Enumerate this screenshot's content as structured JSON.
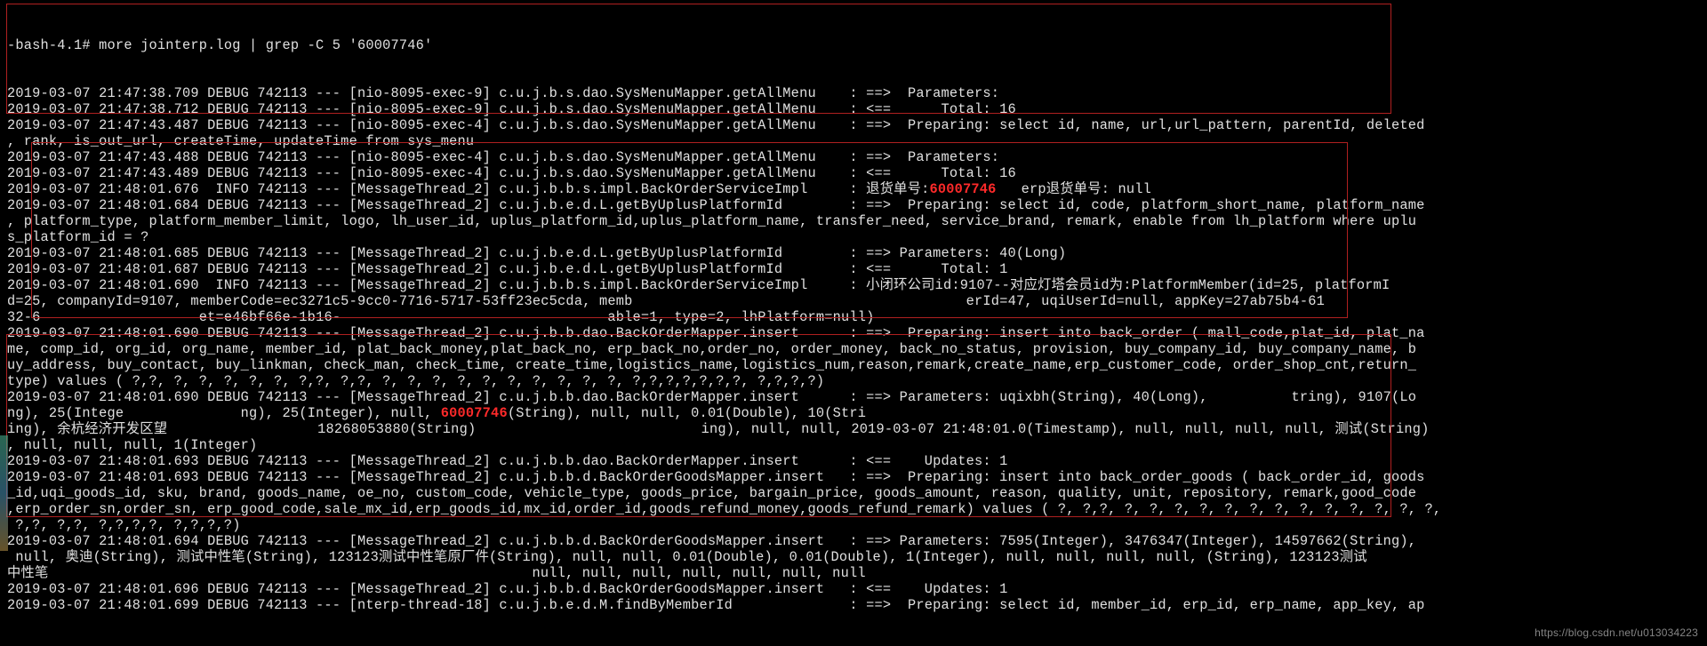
{
  "prompt": "-bash-4.1# more jointerp.log | grep -C 5 '60007746'",
  "highlight": "60007746",
  "watermark": "https://blog.csdn.net/u013034223",
  "lines": [
    "2019-03-07 21:47:38.709 DEBUG 742113 --- [nio-8095-exec-9] c.u.j.b.s.dao.SysMenuMapper.getAllMenu    : ==>  Parameters: ",
    "2019-03-07 21:47:38.712 DEBUG 742113 --- [nio-8095-exec-9] c.u.j.b.s.dao.SysMenuMapper.getAllMenu    : <==      Total: 16",
    "2019-03-07 21:47:43.487 DEBUG 742113 --- [nio-8095-exec-4] c.u.j.b.s.dao.SysMenuMapper.getAllMenu    : ==>  Preparing: select id, name, url,url_pattern, parentId, deleted",
    ", rank, is_out_url, createTime, updateTime from sys_menu ",
    "2019-03-07 21:47:43.488 DEBUG 742113 --- [nio-8095-exec-4] c.u.j.b.s.dao.SysMenuMapper.getAllMenu    : ==>  Parameters: ",
    "2019-03-07 21:47:43.489 DEBUG 742113 --- [nio-8095-exec-4] c.u.j.b.s.dao.SysMenuMapper.getAllMenu    : <==      Total: 16",
    "2019-03-07 21:48:01.676  INFO 742113 --- [MessageThread_2] c.u.j.b.b.s.impl.BackOrderServiceImpl     : 退货单号:{HL}   erp退货单号: null",
    "2019-03-07 21:48:01.684 DEBUG 742113 --- [MessageThread_2] c.u.j.b.e.d.L.getByUplusPlatformId        : ==>  Preparing: select id, code, platform_short_name, platform_name",
    ", platform_type, platform_member_limit, logo, lh_user_id, uplus_platform_id,uplus_platform_name, transfer_need, service_brand, remark, enable from lh_platform where uplu",
    "s_platform_id = ? ",
    "2019-03-07 21:48:01.685 DEBUG 742113 --- [MessageThread_2] c.u.j.b.e.d.L.getByUplusPlatformId        : ==> Parameters: 40(Long)",
    "2019-03-07 21:48:01.687 DEBUG 742113 --- [MessageThread_2] c.u.j.b.e.d.L.getByUplusPlatformId        : <==      Total: 1",
    "2019-03-07 21:48:01.690  INFO 742113 --- [MessageThread_2] c.u.j.b.b.s.impl.BackOrderServiceImpl     : 小闭环公司id:9107--对应灯塔会员id为:PlatformMember(id=25, platformI",
    "d=25, companyId=9107, memberCode=ec3271c5-9cc0-7716-5717-53ff23ec5cda, memb████████████████████████████████████████erId=47, uqiUserId=null, appKey=27ab75b4-61",
    "32-6███████████████████et=e46bf66e-1b16-████████████████████████████████able=1, type=2, lhPlatform=null)",
    "2019-03-07 21:48:01.690 DEBUG 742113 --- [MessageThread_2] c.u.j.b.b.dao.BackOrderMapper.insert      : ==>  Preparing: insert into back_order ( mall_code,plat_id, plat_na",
    "me, comp_id, org_id, org_name, member_id, plat_back_money,plat_back_no, erp_back_no,order_no, order_money, back_no_status, provision, buy_company_id, buy_company_name, b",
    "uy_address, buy_contact, buy_linkman, check_man, check_time, create_time,logistics_name,logistics_num,reason,remark,create_name,erp_customer_code, order_shop_cnt,return_",
    "type) values ( ?,?, ?, ?, ?, ?, ?, ?,?, ?,?, ?, ?, ?, ?, ?, ?, ?, ?, ?, ?, ?,?,?,?,?,?,?, ?,?,?,?) ",
    "2019-03-07 21:48:01.690 DEBUG 742113 --- [MessageThread_2] c.u.j.b.b.dao.BackOrderMapper.insert      : ==> Parameters: uqixbh(String), 40(Long), █████████tring), 9107(Lo",
    "ng), 25(Intege██████████████ng), 25(Integer), null, {HL}(String), null, null, 0.01(Double), 10(Stri██████████████████████████████████████████████████████████████████████",
    "ing), 余杭经济开发区望██████████████████18268053880(String)███████████████████████████ing), null, null, 2019-03-07 21:48:01.0(Timestamp), null, null, null, null, 测试(String)",
    ", null, null, null, 1(Integer)",
    "2019-03-07 21:48:01.693 DEBUG 742113 --- [MessageThread_2] c.u.j.b.b.dao.BackOrderMapper.insert      : <==    Updates: 1",
    "2019-03-07 21:48:01.693 DEBUG 742113 --- [MessageThread_2] c.u.j.b.b.d.BackOrderGoodsMapper.insert   : ==>  Preparing: insert into back_order_goods ( back_order_id, goods",
    "_id,uqi_goods_id, sku, brand, goods_name, oe_no, custom_code, vehicle_type, goods_price, bargain_price, goods_amount, reason, quality, unit, repository, remark,good_code",
    ",erp_order_sn,order_sn, erp_good_code,sale_mx_id,erp_goods_id,mx_id,order_id,goods_refund_money,goods_refund_remark) values ( ?, ?,?, ?, ?, ?, ?, ?, ?, ?, ?, ?, ?, ?, ?, ?,",
    " ?,?, ?,?, ?,?,?,?, ?,?,?,?) ",
    "2019-03-07 21:48:01.694 DEBUG 742113 --- [MessageThread_2] c.u.j.b.b.d.BackOrderGoodsMapper.insert   : ==> Parameters: 7595(Integer), 3476347(Integer), 14597662(String),",
    " null, 奥迪(String), 测试中性笔(String), 123123测试中性笔原厂件(String), null, null, 0.01(Double), 0.01(Double), 1(Integer), null, null, null, null, (String), 123123测试",
    "中性笔█████████████████████████████████████████████████████████ null, null, null, null, null, null, null",
    "2019-03-07 21:48:01.696 DEBUG 742113 --- [MessageThread_2] c.u.j.b.b.d.BackOrderGoodsMapper.insert   : <==    Updates: 1",
    "2019-03-07 21:48:01.699 DEBUG 742113 --- [nterp-thread-18] c.u.j.b.e.d.M.findByMemberId              : ==>  Preparing: select id, member_id, erp_id, erp_name, app_key, ap"
  ]
}
